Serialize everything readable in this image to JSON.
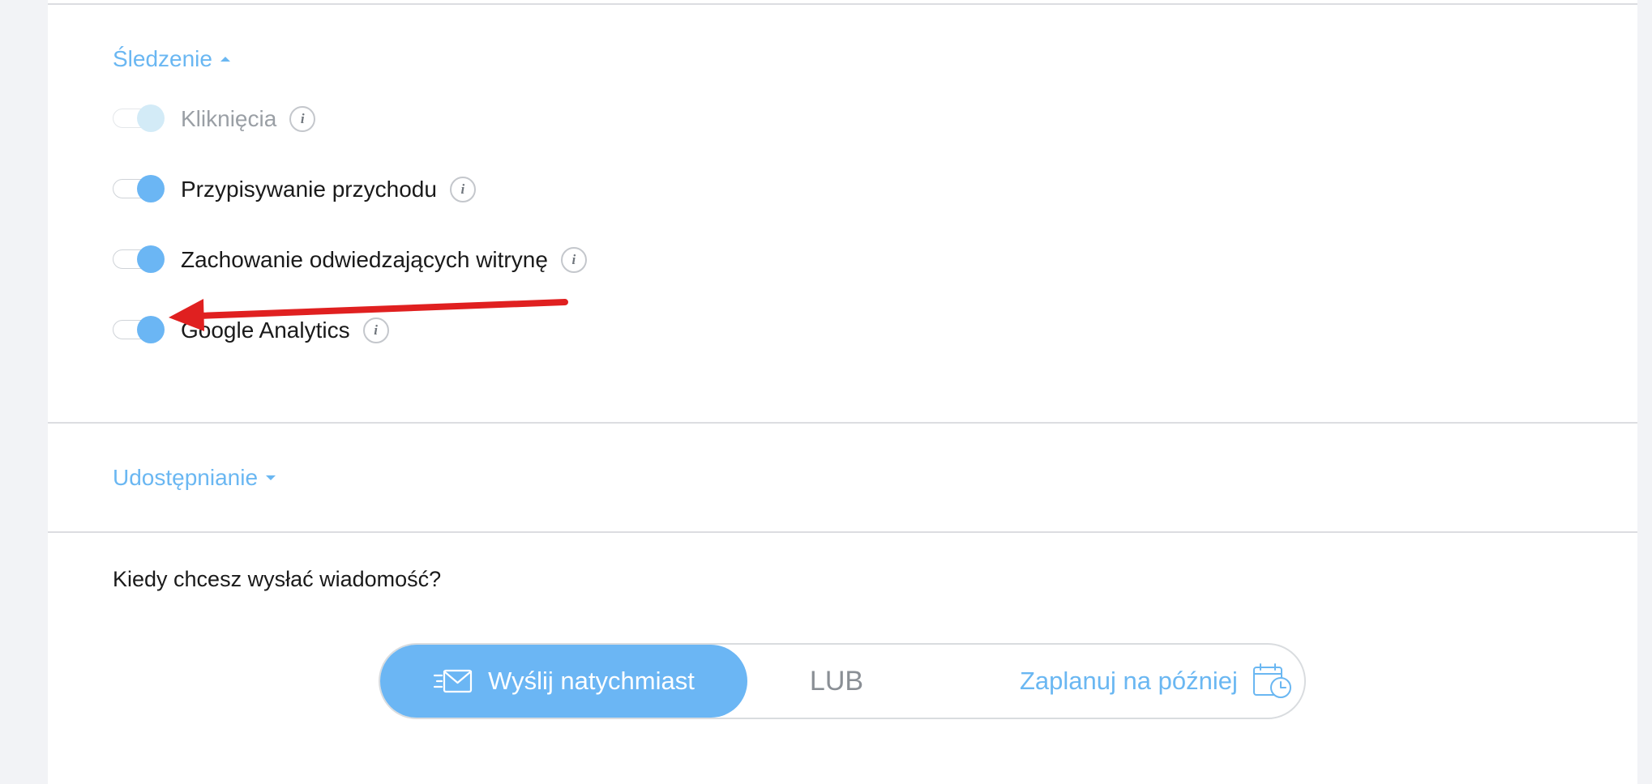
{
  "tracking": {
    "heading": "Śledzenie",
    "options": [
      {
        "label": "Kliknięcia",
        "enabled": true,
        "disabled": true
      },
      {
        "label": "Przypisywanie przychodu",
        "enabled": true,
        "disabled": false
      },
      {
        "label": "Zachowanie odwiedzających witrynę",
        "enabled": true,
        "disabled": false
      },
      {
        "label": "Google Analytics",
        "enabled": true,
        "disabled": false
      }
    ]
  },
  "sharing": {
    "heading": "Udostępnianie"
  },
  "send": {
    "question": "Kiedy chcesz wysłać wiadomość?",
    "send_now_label": "Wyślij natychmiast",
    "or_label": "LUB",
    "schedule_label": "Zaplanuj na później"
  },
  "icons": {
    "info": "info-icon",
    "send_now": "mail-send-icon",
    "schedule": "calendar-clock-icon",
    "tracking_caret": "caret-up-icon",
    "sharing_caret": "caret-down-icon"
  },
  "colors": {
    "accent": "#6bb6f4",
    "annotation_arrow": "#e02020"
  }
}
